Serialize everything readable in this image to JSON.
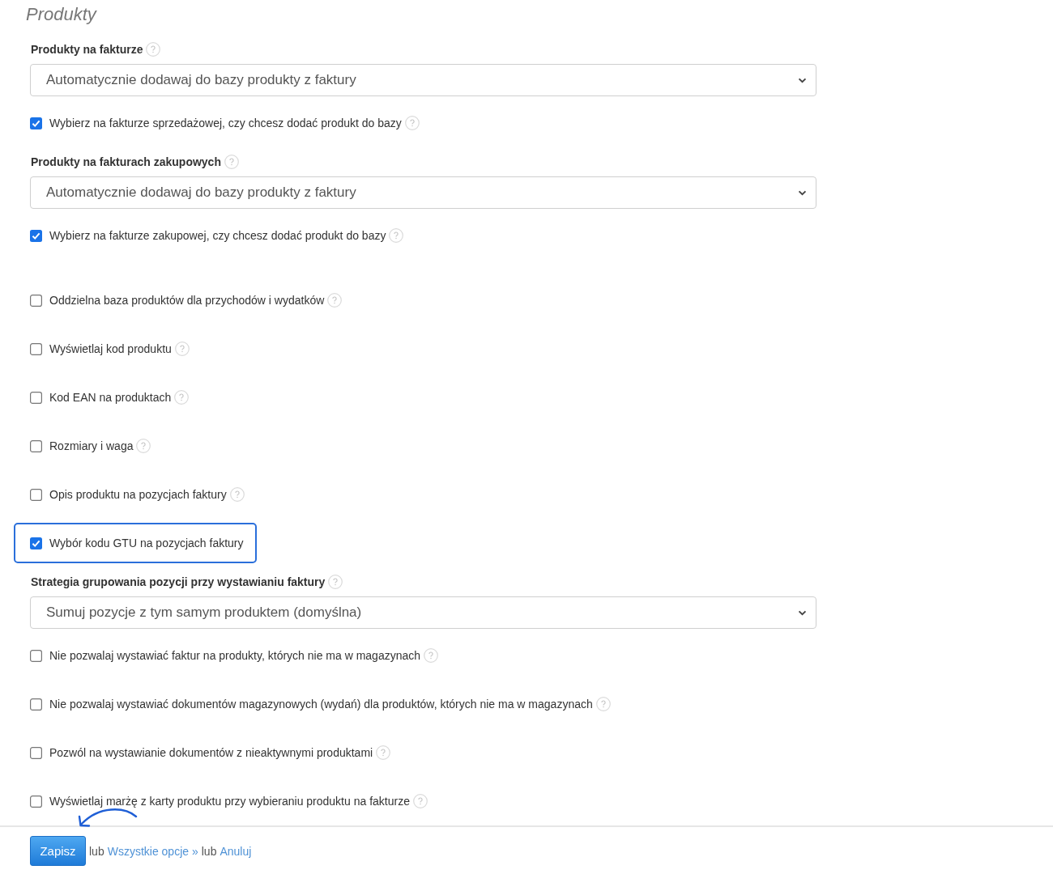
{
  "page": {
    "title": "Produkty"
  },
  "sections": [
    {
      "items": [
        {
          "kind": "select",
          "label": "Produkty na fakturze",
          "help": true,
          "value": "Automatycznie dodawaj do bazy produkty z faktury"
        },
        {
          "kind": "checkbox",
          "label": "Wybierz na fakturze sprzedażowej, czy chcesz dodać produkt do bazy",
          "help": true,
          "checked": true,
          "highlighted": false
        },
        {
          "kind": "select",
          "label": "Produkty na fakturach zakupowych",
          "help": true,
          "value": "Automatycznie dodawaj do bazy produkty z faktury"
        },
        {
          "kind": "checkbox",
          "label": "Wybierz na fakturze zakupowej, czy chcesz dodać produkt do bazy",
          "help": true,
          "checked": true,
          "highlighted": false
        }
      ]
    },
    {
      "items": [
        {
          "kind": "checkbox",
          "label": "Oddzielna baza produktów dla przychodów i wydatków",
          "help": true,
          "checked": false,
          "highlighted": false
        },
        {
          "kind": "checkbox",
          "label": "Wyświetlaj kod produktu",
          "help": true,
          "checked": false,
          "highlighted": false
        },
        {
          "kind": "checkbox",
          "label": "Kod EAN na produktach",
          "help": true,
          "checked": false,
          "highlighted": false
        },
        {
          "kind": "checkbox",
          "label": "Rozmiary i waga",
          "help": true,
          "checked": false,
          "highlighted": false
        },
        {
          "kind": "checkbox",
          "label": "Opis produktu na pozycjach faktury",
          "help": true,
          "checked": false,
          "highlighted": false
        },
        {
          "kind": "checkbox",
          "label": "Wybór kodu GTU na pozycjach faktury",
          "help": false,
          "checked": true,
          "highlighted": true
        },
        {
          "kind": "select",
          "label": "Strategia grupowania pozycji przy wystawianiu faktury",
          "help": true,
          "value": "Sumuj pozycje z tym samym produktem (domyślna)"
        },
        {
          "kind": "checkbox",
          "label": "Nie pozwalaj wystawiać faktur na produkty, których nie ma w magazynach",
          "help": true,
          "checked": false,
          "highlighted": false
        },
        {
          "kind": "checkbox",
          "label": "Nie pozwalaj wystawiać dokumentów magazynowych (wydań) dla produktów, których nie ma w magazynach",
          "help": true,
          "checked": false,
          "highlighted": false
        },
        {
          "kind": "checkbox",
          "label": "Pozwól na wystawianie dokumentów z nieaktywnymi produktami",
          "help": true,
          "checked": false,
          "highlighted": false
        },
        {
          "kind": "checkbox",
          "label": "Wyświetlaj marżę z karty produktu przy wybieraniu produktu na fakturze",
          "help": true,
          "checked": false,
          "highlighted": false
        }
      ]
    }
  ],
  "footer": {
    "button": "Zapisz",
    "parts": [
      {
        "kind": "text",
        "text": "lub"
      },
      {
        "kind": "link",
        "text": "Wszystkie opcje »"
      },
      {
        "kind": "text",
        "text": "lub"
      },
      {
        "kind": "link",
        "text": "Anuluj"
      }
    ]
  }
}
